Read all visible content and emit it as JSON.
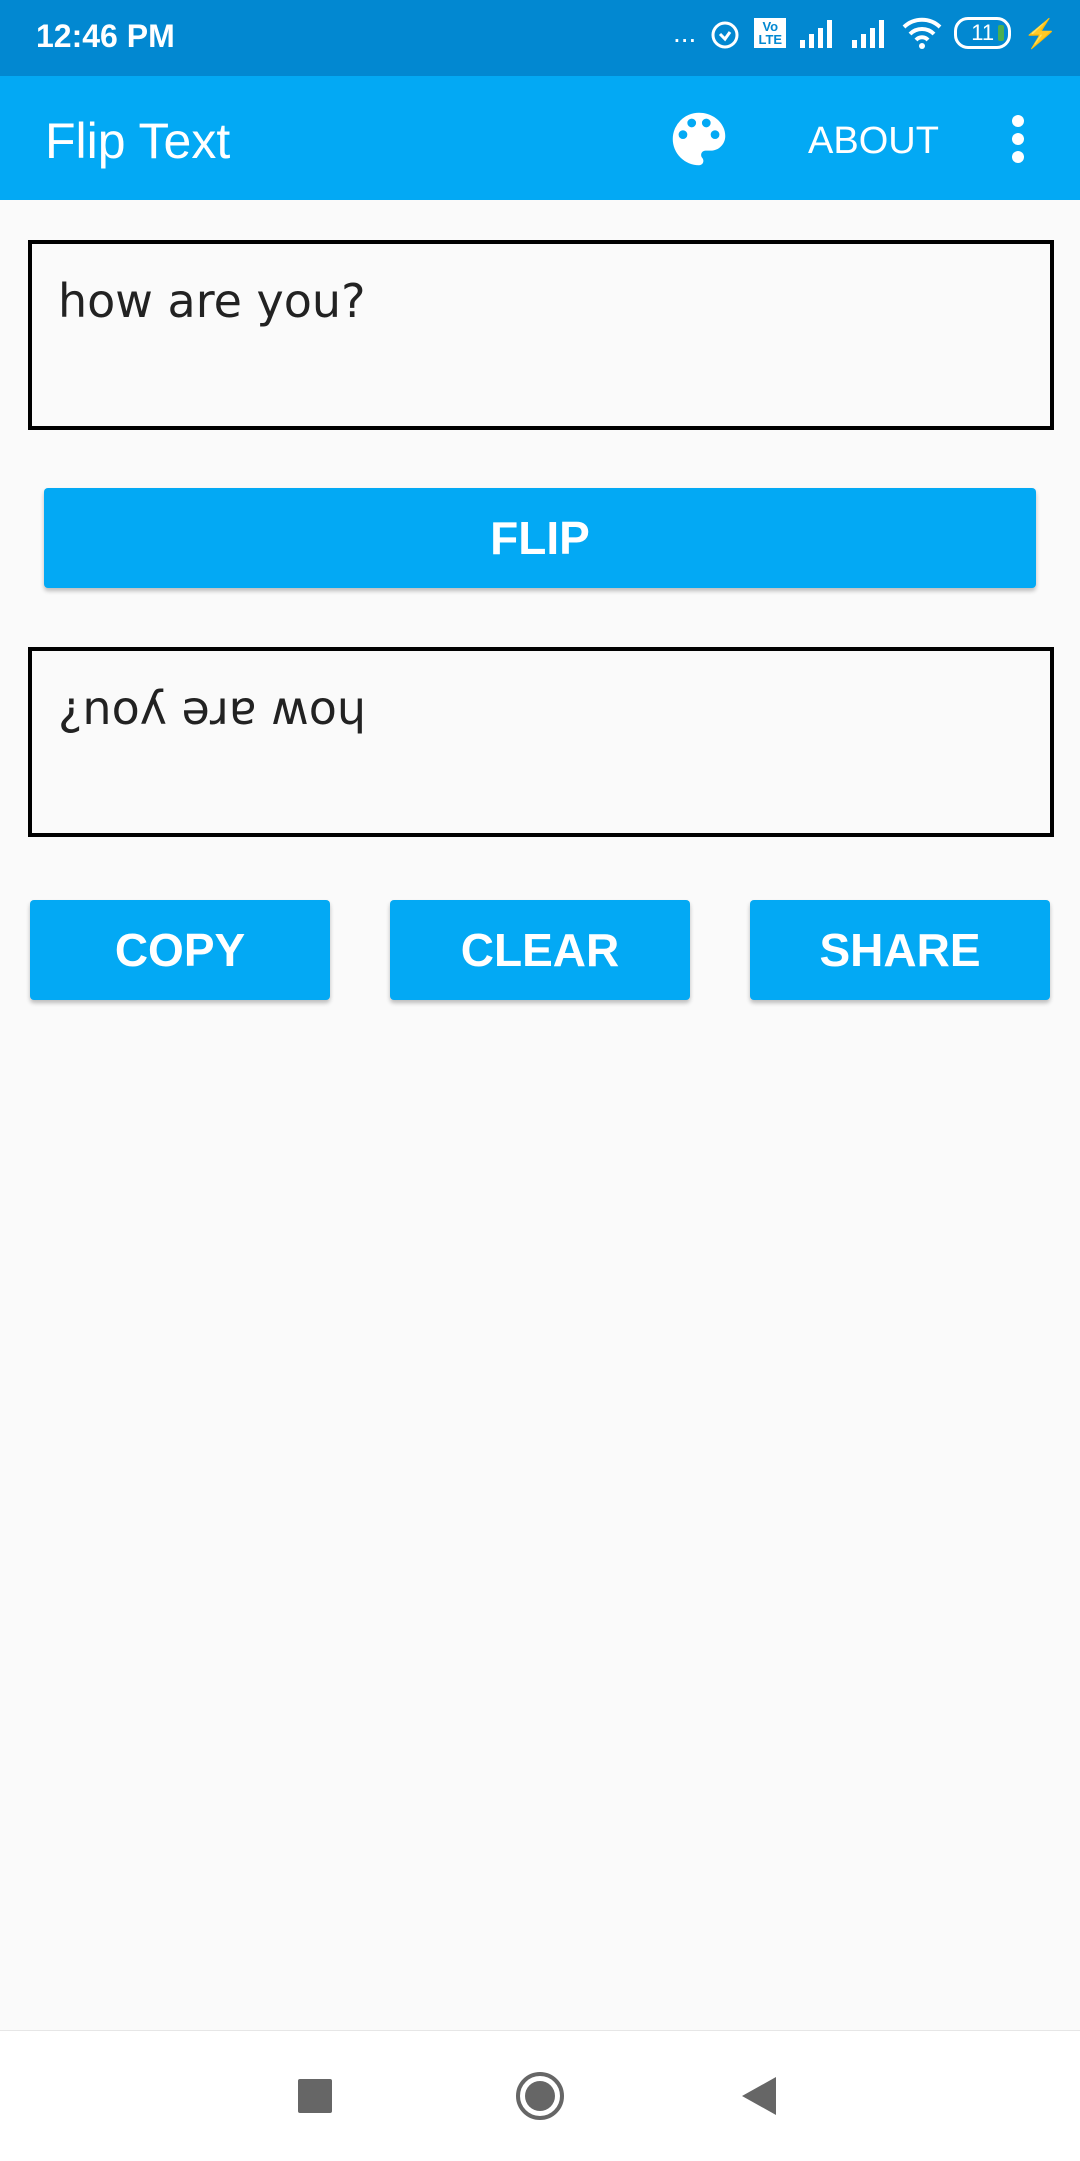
{
  "status_bar": {
    "time": "12:46 PM",
    "dots": "...",
    "volte": "Vo LTE",
    "battery": "11"
  },
  "app_bar": {
    "title": "Flip Text",
    "about_label": "ABOUT",
    "palette_icon": "palette-icon",
    "more_icon": "more-vert-icon"
  },
  "input": {
    "value": "how are you?"
  },
  "flip_button": {
    "label": "FLIP"
  },
  "output": {
    "value": "¿noʎ ǝɹɐ ʍoɥ"
  },
  "actions": {
    "copy": "COPY",
    "clear": "CLEAR",
    "share": "SHARE"
  },
  "colors": {
    "primary": "#03a9f4",
    "primary_dark": "#0288d1",
    "background": "#fafafa"
  }
}
